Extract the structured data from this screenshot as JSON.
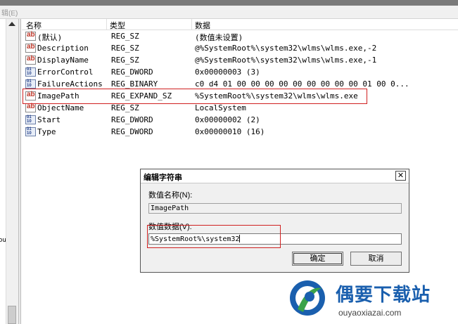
{
  "top_strip": {
    "text": "辑(E)"
  },
  "left_pane": {
    "fragment": "ou"
  },
  "list": {
    "headers": {
      "name": "名称",
      "type": "类型",
      "data": "数据"
    },
    "rows": [
      {
        "icon": "string-value-icon",
        "name": "(默认)",
        "type": "REG_SZ",
        "data": "(数值未设置)"
      },
      {
        "icon": "string-value-icon",
        "name": "Description",
        "type": "REG_SZ",
        "data": "@%SystemRoot%\\system32\\wlms\\wlms.exe,-2"
      },
      {
        "icon": "string-value-icon",
        "name": "DisplayName",
        "type": "REG_SZ",
        "data": "@%SystemRoot%\\system32\\wlms\\wlms.exe,-1"
      },
      {
        "icon": "binary-value-icon",
        "name": "ErrorControl",
        "type": "REG_DWORD",
        "data": "0x00000003 (3)"
      },
      {
        "icon": "binary-value-icon",
        "name": "FailureActions",
        "type": "REG_BINARY",
        "data": "c0 d4 01 00 00 00 00 00 00 00 00 00 01 00 0..."
      },
      {
        "icon": "string-value-icon",
        "name": "ImagePath",
        "type": "REG_EXPAND_SZ",
        "data": "%SystemRoot%\\system32\\wlms\\wlms.exe"
      },
      {
        "icon": "string-value-icon",
        "name": "ObjectName",
        "type": "REG_SZ",
        "data": "LocalSystem"
      },
      {
        "icon": "binary-value-icon",
        "name": "Start",
        "type": "REG_DWORD",
        "data": "0x00000002 (2)"
      },
      {
        "icon": "binary-value-icon",
        "name": "Type",
        "type": "REG_DWORD",
        "data": "0x00000010 (16)"
      }
    ]
  },
  "dialog": {
    "title": "编辑字符串",
    "close_label": "✕",
    "name_label": "数值名称(N):",
    "name_value": "ImagePath",
    "data_label": "数值数据(V):",
    "data_value": "%SystemRoot%\\system32",
    "ok_label": "确定",
    "cancel_label": "取消"
  },
  "watermark": {
    "title": "偶要下载站",
    "url": "ouyaoxiazai.com"
  },
  "colors": {
    "highlight": "#d02020",
    "brand": "#1a5fae"
  }
}
